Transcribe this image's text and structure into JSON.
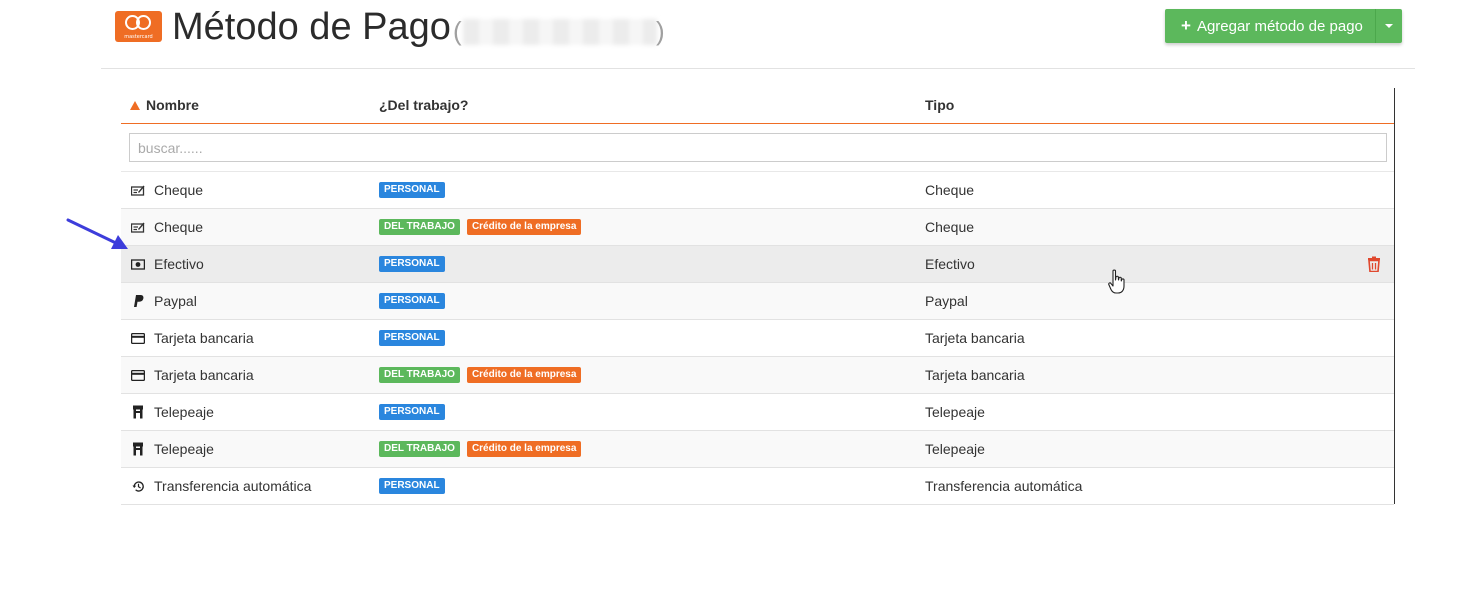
{
  "header": {
    "logo_text": "mastercard",
    "title": "Método de Pago",
    "paren_open": "(",
    "paren_close": ")",
    "add_button_label": "Agregar método de pago",
    "add_button_icon": "plus-icon",
    "dropdown_icon": "caret-down-icon"
  },
  "colors": {
    "accent": "#ef6d24",
    "success": "#5cb85c",
    "personal": "#2a86de",
    "work": "#5cb85c",
    "company_credit": "#ef6d24",
    "danger": "#e0482e"
  },
  "table": {
    "columns": [
      {
        "label": "Nombre",
        "sorted": "asc"
      },
      {
        "label": "¿Del trabajo?"
      },
      {
        "label": "Tipo"
      }
    ],
    "search_placeholder": "buscar......",
    "rows": [
      {
        "name": "Cheque",
        "icon": "check-icon",
        "badges": [
          {
            "text": "PERSONAL",
            "kind": "personal"
          }
        ],
        "type": "Cheque"
      },
      {
        "name": "Cheque",
        "icon": "check-icon",
        "badges": [
          {
            "text": "DEL TRABAJO",
            "kind": "work"
          },
          {
            "text": "Crédito de la empresa",
            "kind": "credit"
          }
        ],
        "type": "Cheque"
      },
      {
        "name": "Efectivo",
        "icon": "cash-icon",
        "badges": [
          {
            "text": "PERSONAL",
            "kind": "personal"
          }
        ],
        "type": "Efectivo",
        "hovered": true,
        "action_icon": "trash-icon"
      },
      {
        "name": "Paypal",
        "icon": "paypal-icon",
        "badges": [
          {
            "text": "PERSONAL",
            "kind": "personal"
          }
        ],
        "type": "Paypal"
      },
      {
        "name": "Tarjeta bancaria",
        "icon": "credit-card-icon",
        "badges": [
          {
            "text": "PERSONAL",
            "kind": "personal"
          }
        ],
        "type": "Tarjeta bancaria"
      },
      {
        "name": "Tarjeta bancaria",
        "icon": "credit-card-icon",
        "badges": [
          {
            "text": "DEL TRABAJO",
            "kind": "work"
          },
          {
            "text": "Crédito de la empresa",
            "kind": "credit"
          }
        ],
        "type": "Tarjeta bancaria"
      },
      {
        "name": "Telepeaje",
        "icon": "toll-road-icon",
        "badges": [
          {
            "text": "PERSONAL",
            "kind": "personal"
          }
        ],
        "type": "Telepeaje"
      },
      {
        "name": "Telepeaje",
        "icon": "toll-road-icon",
        "badges": [
          {
            "text": "DEL TRABAJO",
            "kind": "work"
          },
          {
            "text": "Crédito de la empresa",
            "kind": "credit"
          }
        ],
        "type": "Telepeaje"
      },
      {
        "name": "Transferencia automática",
        "icon": "history-icon",
        "badges": [
          {
            "text": "PERSONAL",
            "kind": "personal"
          }
        ],
        "type": "Transferencia automática"
      }
    ]
  }
}
